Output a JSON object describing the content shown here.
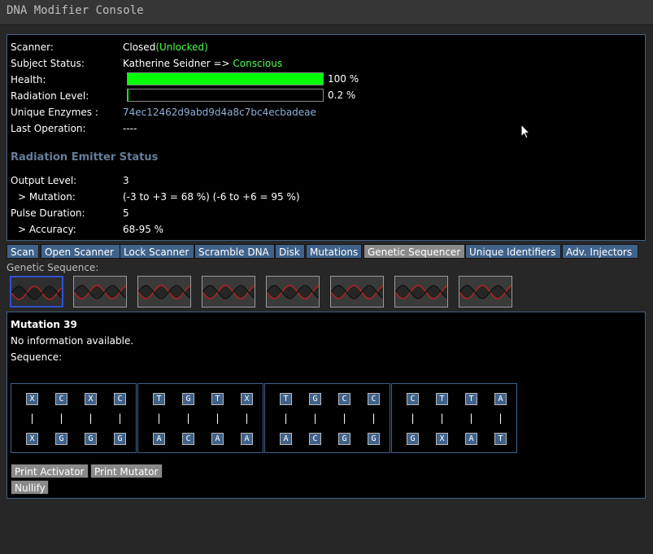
{
  "window": {
    "title": "DNA Modifier Console"
  },
  "status": {
    "scanner_label": "Scanner:",
    "scanner_value": "Closed",
    "scanner_lock": "(Unlocked)",
    "subject_label": "Subject Status:",
    "subject_name": "Katherine Seidner =>",
    "subject_state": "Conscious",
    "health_label": "Health:",
    "health_value": "100 %",
    "health_fraction": 1.0,
    "radiation_label": "Radiation Level:",
    "radiation_value": "0.2 %",
    "radiation_fraction": 0.002,
    "enzymes_label": "Unique Enzymes :",
    "enzymes_value": "74ec12462d9abd9d4a8c7bc4ecbadeae",
    "last_op_label": "Last Operation:",
    "last_op_value": "----"
  },
  "emitter": {
    "title": "Radiation Emitter Status",
    "output_label": "Output Level:",
    "output_value": "3",
    "mutation_label": "> Mutation:",
    "mutation_value": "(-3 to +3 = 68 %) (-6 to +6 = 95 %)",
    "pulse_label": "Pulse Duration:",
    "pulse_value": "5",
    "accuracy_label": "> Accuracy:",
    "accuracy_value": "68-95 %"
  },
  "tabs": [
    {
      "label": "Scan",
      "active": false
    },
    {
      "label": "Open Scanner",
      "active": false
    },
    {
      "label": "Lock Scanner",
      "active": false
    },
    {
      "label": "Scramble DNA",
      "active": false
    },
    {
      "label": "Disk",
      "active": false
    },
    {
      "label": "Mutations",
      "active": false
    },
    {
      "label": "Genetic Sequencer",
      "active": true
    },
    {
      "label": "Unique Identifiers",
      "active": false
    },
    {
      "label": "Adv. Injectors",
      "active": false
    }
  ],
  "sequence_label": "Genetic Sequence:",
  "thumbnails": {
    "count": 8,
    "selected_index": 0,
    "icon": "dna-helix-icon"
  },
  "detail": {
    "title": "Mutation 39",
    "info": "No information available.",
    "sequence_label": "Sequence:",
    "blocks": [
      {
        "top": [
          "X",
          "C",
          "X",
          "C"
        ],
        "bottom": [
          "X",
          "G",
          "G",
          "G"
        ]
      },
      {
        "top": [
          "T",
          "G",
          "T",
          "X"
        ],
        "bottom": [
          "A",
          "C",
          "A",
          "A"
        ]
      },
      {
        "top": [
          "T",
          "G",
          "C",
          "C"
        ],
        "bottom": [
          "A",
          "C",
          "G",
          "G"
        ]
      },
      {
        "top": [
          "C",
          "T",
          "T",
          "A"
        ],
        "bottom": [
          "G",
          "X",
          "A",
          "T"
        ]
      }
    ],
    "pair_symbol": "|"
  },
  "actions": {
    "print_activator": "Print Activator",
    "print_mutator": "Print Mutator",
    "nullify": "Nullify"
  },
  "colors": {
    "accent": "#40628a",
    "good": "#4cff4c",
    "health_bar": "#00ff00",
    "section_title": "#657d99"
  }
}
